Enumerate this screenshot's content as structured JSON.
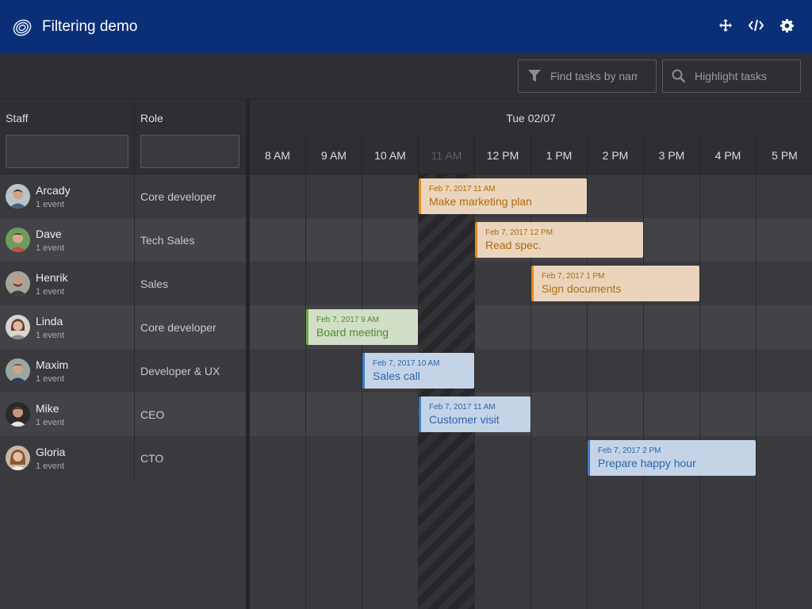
{
  "header": {
    "title": "Filtering demo",
    "tools": [
      {
        "icon": "move-icon"
      },
      {
        "icon": "code-icon"
      },
      {
        "icon": "gear-icon"
      }
    ]
  },
  "toolbar": {
    "filter_placeholder": "Find tasks by name",
    "filter_icon": "filter-icon",
    "highlight_placeholder": "Highlight tasks",
    "highlight_icon": "search-icon"
  },
  "columns": {
    "staff": "Staff",
    "role": "Role"
  },
  "timeline": {
    "day": "Tue 02/07",
    "hours": [
      "8 AM",
      "9 AM",
      "10 AM",
      "11 AM",
      "12 PM",
      "1 PM",
      "2 PM",
      "3 PM",
      "4 PM",
      "5 PM"
    ],
    "dimmed_hour": "11 AM"
  },
  "resources": [
    {
      "name": "Arcady",
      "events": "1 event",
      "role": "Core developer"
    },
    {
      "name": "Dave",
      "events": "1 event",
      "role": "Tech Sales"
    },
    {
      "name": "Henrik",
      "events": "1 event",
      "role": "Sales"
    },
    {
      "name": "Linda",
      "events": "1 event",
      "role": "Core developer"
    },
    {
      "name": "Maxim",
      "events": "1 event",
      "role": "Developer & UX"
    },
    {
      "name": "Mike",
      "events": "1 event",
      "role": "CEO"
    },
    {
      "name": "Gloria",
      "events": "1 event",
      "role": "CTO"
    }
  ],
  "events": [
    {
      "date": "Feb 7, 2017 11 AM",
      "name": "Make marketing plan",
      "color": "orange"
    },
    {
      "date": "Feb 7, 2017 12 PM",
      "name": "Read spec.",
      "color": "orange"
    },
    {
      "date": "Feb 7, 2017 1 PM",
      "name": "Sign documents",
      "color": "orange"
    },
    {
      "date": "Feb 7, 2017 9 AM",
      "name": "Board meeting",
      "color": "green"
    },
    {
      "date": "Feb 7, 2017 10 AM",
      "name": "Sales call",
      "color": "blue"
    },
    {
      "date": "Feb 7, 2017 11 AM",
      "name": "Customer visit",
      "color": "blue"
    },
    {
      "date": "Feb 7, 2017 2 PM",
      "name": "Prepare happy hour",
      "color": "blue"
    }
  ],
  "colors": {
    "header_bg": "#0b2f77",
    "orange": "#e08a1e",
    "green": "#6fae45",
    "blue": "#3d7cc9"
  }
}
